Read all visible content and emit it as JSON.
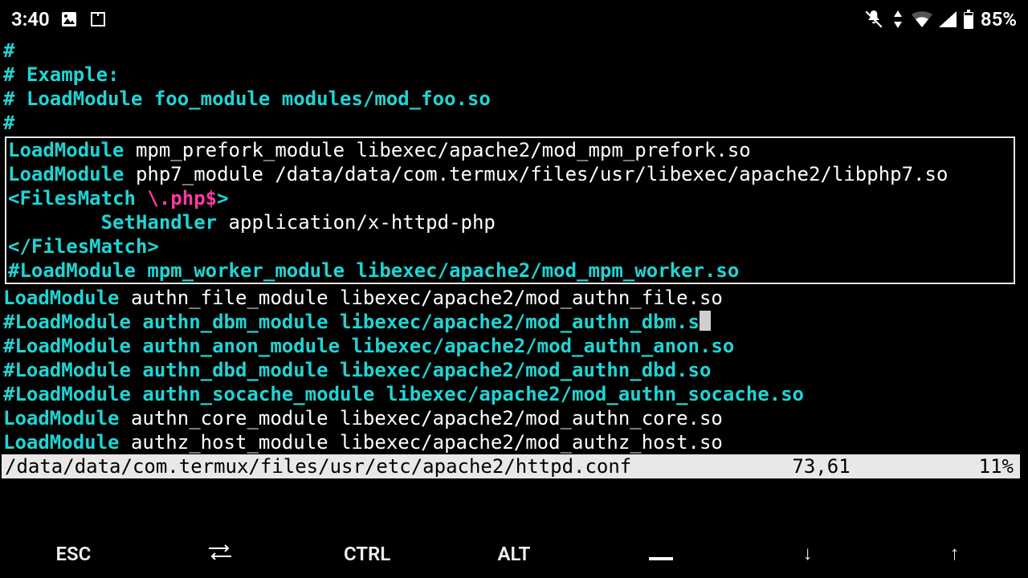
{
  "status_bar": {
    "time": "3:40",
    "battery": "85%"
  },
  "selection_border": true,
  "lines": [
    {
      "in_box": false,
      "segs": [
        {
          "cls": "c-comment",
          "t": "#"
        }
      ]
    },
    {
      "in_box": false,
      "segs": [
        {
          "cls": "c-comment",
          "t": "# Example:"
        }
      ]
    },
    {
      "in_box": false,
      "segs": [
        {
          "cls": "c-comment",
          "t": "# LoadModule foo_module modules/mod_foo.so"
        }
      ]
    },
    {
      "in_box": false,
      "segs": [
        {
          "cls": "c-comment",
          "t": "#"
        }
      ]
    },
    {
      "in_box": true,
      "segs": [
        {
          "cls": "c-keyword",
          "t": "LoadModule"
        },
        {
          "cls": "c-plain",
          "t": " mpm_prefork_module libexec/apache2/mod_mpm_prefork.so"
        }
      ]
    },
    {
      "in_box": true,
      "segs": [
        {
          "cls": "c-keyword",
          "t": "LoadModule"
        },
        {
          "cls": "c-plain",
          "t": " php7_module /data/data/com.termux/files/usr/libexec/apache2/libphp7.so"
        }
      ]
    },
    {
      "in_box": true,
      "segs": [
        {
          "cls": "c-keyword",
          "t": "<FilesMatch "
        },
        {
          "cls": "c-regex",
          "t": "\\.php$"
        },
        {
          "cls": "c-keyword",
          "t": ">"
        }
      ]
    },
    {
      "in_box": true,
      "segs": [
        {
          "cls": "c-plain",
          "t": "        "
        },
        {
          "cls": "c-keyword",
          "t": "SetHandler"
        },
        {
          "cls": "c-plain",
          "t": " application/x-httpd-php"
        }
      ]
    },
    {
      "in_box": true,
      "segs": [
        {
          "cls": "c-keyword",
          "t": "</FilesMatch>"
        }
      ]
    },
    {
      "in_box": true,
      "segs": [
        {
          "cls": "c-comment",
          "t": "#LoadModule mpm_worker_module libexec/apache2/mod_mpm_worker.so"
        }
      ]
    },
    {
      "in_box": false,
      "segs": [
        {
          "cls": "c-keyword",
          "t": "LoadModule"
        },
        {
          "cls": "c-plain",
          "t": " authn_file_module libexec/apache2/mod_authn_file.so"
        }
      ]
    },
    {
      "in_box": false,
      "cursor_after": true,
      "segs": [
        {
          "cls": "c-comment",
          "t": "#LoadModule authn_dbm_module libexec/apache2/mod_authn_dbm.so"
        }
      ]
    },
    {
      "in_box": false,
      "segs": [
        {
          "cls": "c-comment",
          "t": "#LoadModule authn_anon_module libexec/apache2/mod_authn_anon.so"
        }
      ]
    },
    {
      "in_box": false,
      "segs": [
        {
          "cls": "c-comment",
          "t": "#LoadModule authn_dbd_module libexec/apache2/mod_authn_dbd.so"
        }
      ]
    },
    {
      "in_box": false,
      "segs": [
        {
          "cls": "c-comment",
          "t": "#LoadModule authn_socache_module libexec/apache2/mod_authn_socache.so"
        }
      ]
    },
    {
      "in_box": false,
      "segs": [
        {
          "cls": "c-keyword",
          "t": "LoadModule"
        },
        {
          "cls": "c-plain",
          "t": " authn_core_module libexec/apache2/mod_authn_core.so"
        }
      ]
    },
    {
      "in_box": false,
      "segs": [
        {
          "cls": "c-keyword",
          "t": "LoadModule"
        },
        {
          "cls": "c-plain",
          "t": " authz_host_module libexec/apache2/mod_authz_host.so"
        }
      ]
    }
  ],
  "vim_status": {
    "file": "/data/data/com.termux/files/usr/etc/apache2/httpd.conf",
    "pos": "73,61",
    "pct": "11%"
  },
  "keys": {
    "esc": "ESC",
    "ctrl": "CTRL",
    "alt": "ALT",
    "down": "↓",
    "up": "↑"
  }
}
